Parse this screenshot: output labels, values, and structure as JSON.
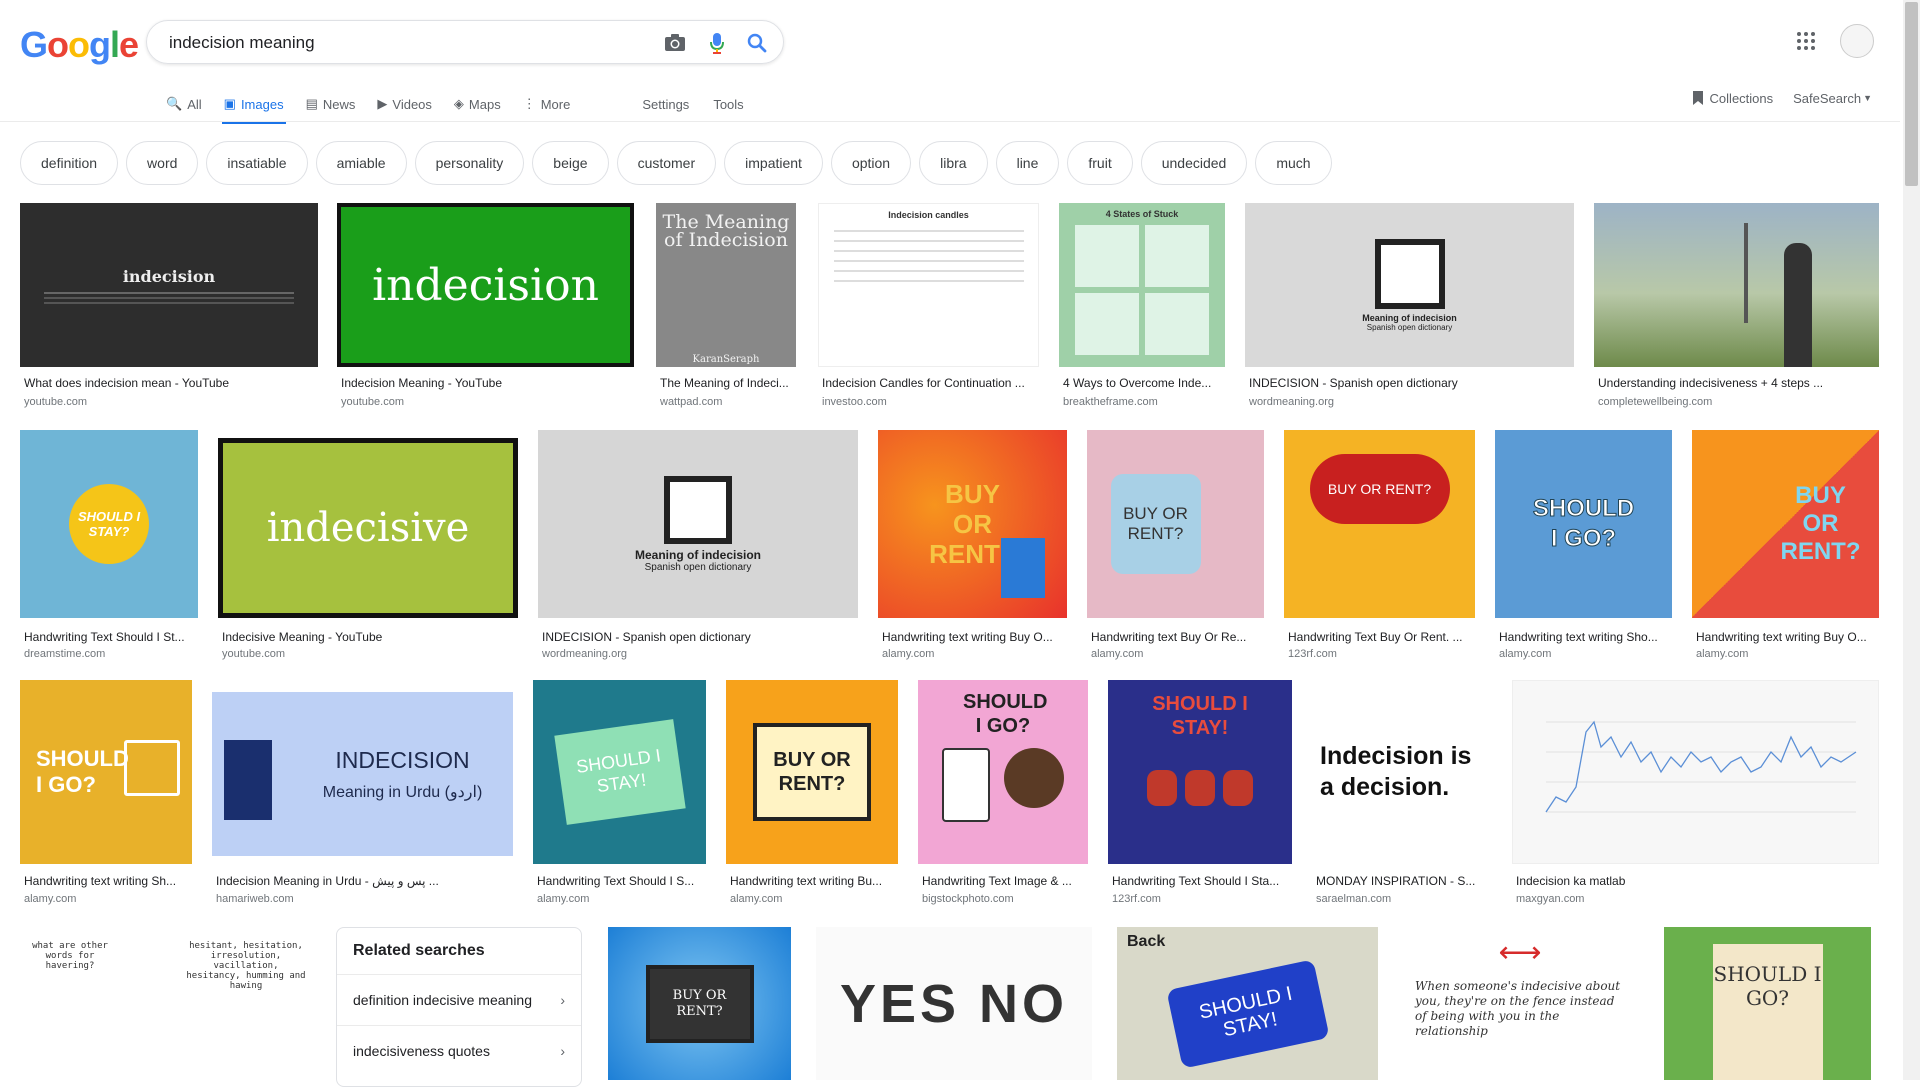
{
  "logo": {
    "letters": [
      "G",
      "o",
      "o",
      "g",
      "l",
      "e"
    ],
    "colors": [
      "#4285f4",
      "#ea4335",
      "#fbbc05",
      "#4285f4",
      "#34a853",
      "#ea4335"
    ]
  },
  "search": {
    "value": "indecision meaning"
  },
  "icons": {
    "camera": "camera-icon",
    "mic": "microphone-icon",
    "search": "search-icon",
    "apps": "apps-grid-icon",
    "collections": "bookmark-icon"
  },
  "tabs": [
    {
      "label": "All",
      "icon": "🔍"
    },
    {
      "label": "Images",
      "icon": "▣"
    },
    {
      "label": "News",
      "icon": "▤"
    },
    {
      "label": "Videos",
      "icon": "▶"
    },
    {
      "label": "Maps",
      "icon": "◈"
    },
    {
      "label": "More",
      "icon": "⋮"
    }
  ],
  "tools": {
    "settings": "Settings",
    "tools": "Tools",
    "collections": "Collections",
    "safesearch": "SafeSearch"
  },
  "chips": [
    "definition",
    "word",
    "insatiable",
    "amiable",
    "personality",
    "beige",
    "customer",
    "impatient",
    "option",
    "libra",
    "line",
    "fruit",
    "undecided",
    "much"
  ],
  "results": [
    {
      "caption": "What does indecision mean - YouTube",
      "domain": "youtube.com",
      "text": "indecision"
    },
    {
      "caption": "Indecision Meaning - YouTube",
      "domain": "youtube.com",
      "text": "indecision"
    },
    {
      "caption": "The Meaning of Indeci...",
      "domain": "wattpad.com",
      "text": "The Meaning of Indecision",
      "subtext": "KaranSeraph"
    },
    {
      "caption": "Indecision Candles for Continuation ...",
      "domain": "investoo.com",
      "text": "Indecision candles"
    },
    {
      "caption": "4 Ways to Overcome Inde...",
      "domain": "breaktheframe.com",
      "text": "4 States of Stuck"
    },
    {
      "caption": "INDECISION - Spanish open dictionary",
      "domain": "wordmeaning.org",
      "text": "Meaning of indecision",
      "subtext": "Spanish open dictionary"
    },
    {
      "caption": "Understanding indecisiveness + 4 steps ...",
      "domain": "completewellbeing.com",
      "text": ""
    },
    {
      "caption": "Handwriting Text Should I St...",
      "domain": "dreamstime.com",
      "text": "SHOULD I STAY?"
    },
    {
      "caption": "Indecisive Meaning - YouTube",
      "domain": "youtube.com",
      "text": "indecisive"
    },
    {
      "caption": "INDECISION - Spanish open dictionary",
      "domain": "wordmeaning.org",
      "text": "Meaning of indecision",
      "subtext": "Spanish open dictionary"
    },
    {
      "caption": "Handwriting text writing Buy O...",
      "domain": "alamy.com",
      "text": "BUY OR RENT?"
    },
    {
      "caption": "Handwriting text Buy Or Re...",
      "domain": "alamy.com",
      "text": "BUY OR RENT?"
    },
    {
      "caption": "Handwriting Text Buy Or Rent. ...",
      "domain": "123rf.com",
      "text": "BUY OR RENT?"
    },
    {
      "caption": "Handwriting text writing Sho...",
      "domain": "alamy.com",
      "text": "SHOULD I GO?"
    },
    {
      "caption": "Handwriting text writing Buy O...",
      "domain": "alamy.com",
      "text": "BUY OR RENT?"
    },
    {
      "caption": "Handwriting text writing Sh...",
      "domain": "alamy.com",
      "text": "SHOULD I GO?"
    },
    {
      "caption": "Indecision Meaning in Urdu - پس و پیش ...",
      "domain": "hamariweb.com",
      "text": "INDECISION",
      "subtext": "Meaning in Urdu (اردو)"
    },
    {
      "caption": "Handwriting Text Should I S...",
      "domain": "alamy.com",
      "text": "SHOULD I STAY!"
    },
    {
      "caption": "Handwriting text writing Bu...",
      "domain": "alamy.com",
      "text": "BUY OR RENT?"
    },
    {
      "caption": "Handwriting Text Image & ...",
      "domain": "bigstockphoto.com",
      "text": "SHOULD I GO?"
    },
    {
      "caption": "Handwriting Text Should I Sta...",
      "domain": "123rf.com",
      "text": "SHOULD I STAY!"
    },
    {
      "caption": "MONDAY INSPIRATION - S...",
      "domain": "saraelman.com",
      "text": "Indecision is a decision."
    },
    {
      "caption": "Indecision ka matlab",
      "domain": "maxgyan.com",
      "text": ""
    },
    {
      "caption": "",
      "domain": "",
      "text": "what are other words for havering?",
      "subtext": "hesitant, hesitation, irresolution, vacillation, hesitancy, humming and hawing"
    },
    {
      "caption": "",
      "domain": "",
      "text": "BUY OR RENT?"
    },
    {
      "caption": "",
      "domain": "",
      "text": "YES NO"
    },
    {
      "caption": "",
      "domain": "",
      "text": "SHOULD I STAY!",
      "subtext": "Back"
    },
    {
      "caption": "",
      "domain": "",
      "text": "When someone's indecisive about you, they're on the fence instead of being with you in the relationship"
    },
    {
      "caption": "",
      "domain": "",
      "text": "SHOULD I GO?"
    }
  ],
  "related": {
    "title": "Related searches",
    "items": [
      "definition indecisive meaning",
      "indecisiveness quotes"
    ]
  }
}
